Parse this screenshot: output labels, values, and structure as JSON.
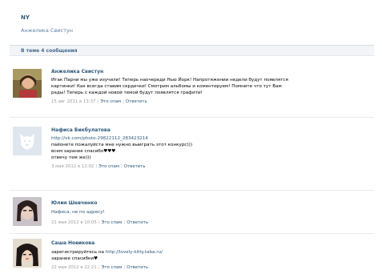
{
  "topic": {
    "title": "NY",
    "author": "Анжелика Свистун"
  },
  "count_label": "В теме 4 сообщения",
  "posts": [
    {
      "author": "Анжелика Свистун",
      "lines": [
        "Итак Парни мы уже изучили! Теперь наочереди Нью Йорк! Напротяжении недели будут появлятся",
        "картинки! Как всегда ставим сердечки! Смотрим альбомы и коментируем! Помните что тут Вам",
        "рады! Теперь с каждой новой темой будут появлятся графити!"
      ],
      "date": "15 авг 2011 в 13:37",
      "reply_label": "Это спам",
      "answer_label": "Ответить"
    },
    {
      "author": "Нафиса Бикбулатова",
      "link": "http://vk.com/photo-29822112_283423214",
      "lines": [
        "пайонете пожалуйста мне нужно выиграть этот конкурс)))",
        "всем заранее спасибо",
        "отвечу тем же)))"
      ],
      "hearts": "♥♥♥",
      "date": "3 мая 2012 в 12:02",
      "reply_label": "Это спам",
      "answer_label": "Ответить"
    },
    {
      "author": "Юлия Шевченко",
      "lines": [
        "Нафиса, не по адресу!"
      ],
      "date": "21 мая 2012 в 10:05",
      "reply_label": "Это спам",
      "answer_label": "Ответить"
    },
    {
      "author": "Саша Новикова",
      "lines": [
        "зарегистрируйтесь на",
        "заранее спасибки"
      ],
      "link": "http://lovely-kitty.taba.ru/",
      "hearts": "♥",
      "date": "22 мая 2012 в 22:21",
      "reply_label": "Это спам",
      "answer_label": "Ответить"
    }
  ],
  "icons": {
    "avatar_1": "avatar-photo-icon",
    "avatar_2": "vk-dog-placeholder-icon",
    "avatar_3": "avatar-photo-icon",
    "avatar_4": "avatar-photo-icon"
  }
}
